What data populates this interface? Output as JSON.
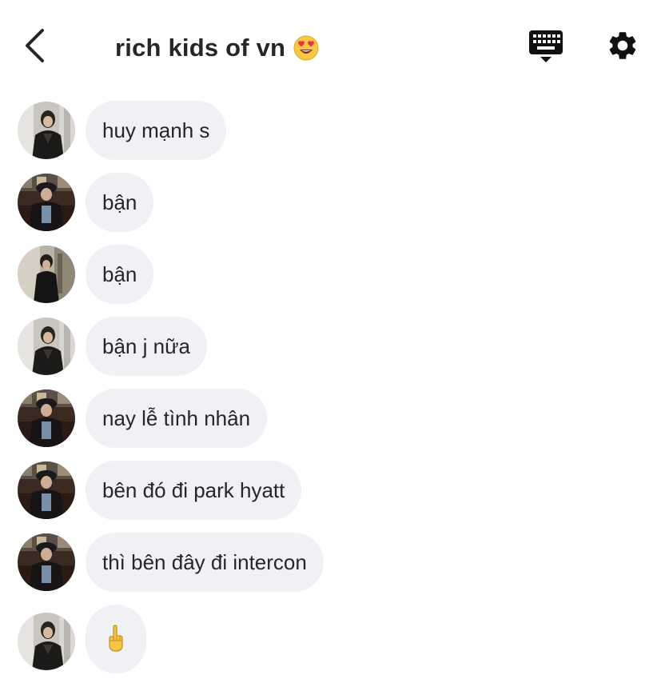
{
  "header": {
    "title": "rich kids of vn",
    "title_emoji": "heart-eyes-emoji",
    "back_icon": "chevron-left-icon",
    "keyboard_icon": "keyboard-icon",
    "settings_icon": "gear-icon"
  },
  "colors": {
    "bubble_bg": "#eff1f5",
    "text": "#262626",
    "background": "#ffffff"
  },
  "messages": [
    {
      "text": "huy mạnh s",
      "avatar": "avatar-a"
    },
    {
      "text": "bận",
      "avatar": "avatar-b"
    },
    {
      "text": "bận",
      "avatar": "avatar-c"
    },
    {
      "text": "bận j nữa",
      "avatar": "avatar-a"
    },
    {
      "text": "nay lễ tình nhân",
      "avatar": "avatar-b"
    },
    {
      "text": "bên đó đi park hyatt",
      "avatar": "avatar-b"
    },
    {
      "text": "thì bên đây đi intercon",
      "avatar": "avatar-b"
    },
    {
      "text": "🖕",
      "avatar": "avatar-a"
    }
  ]
}
